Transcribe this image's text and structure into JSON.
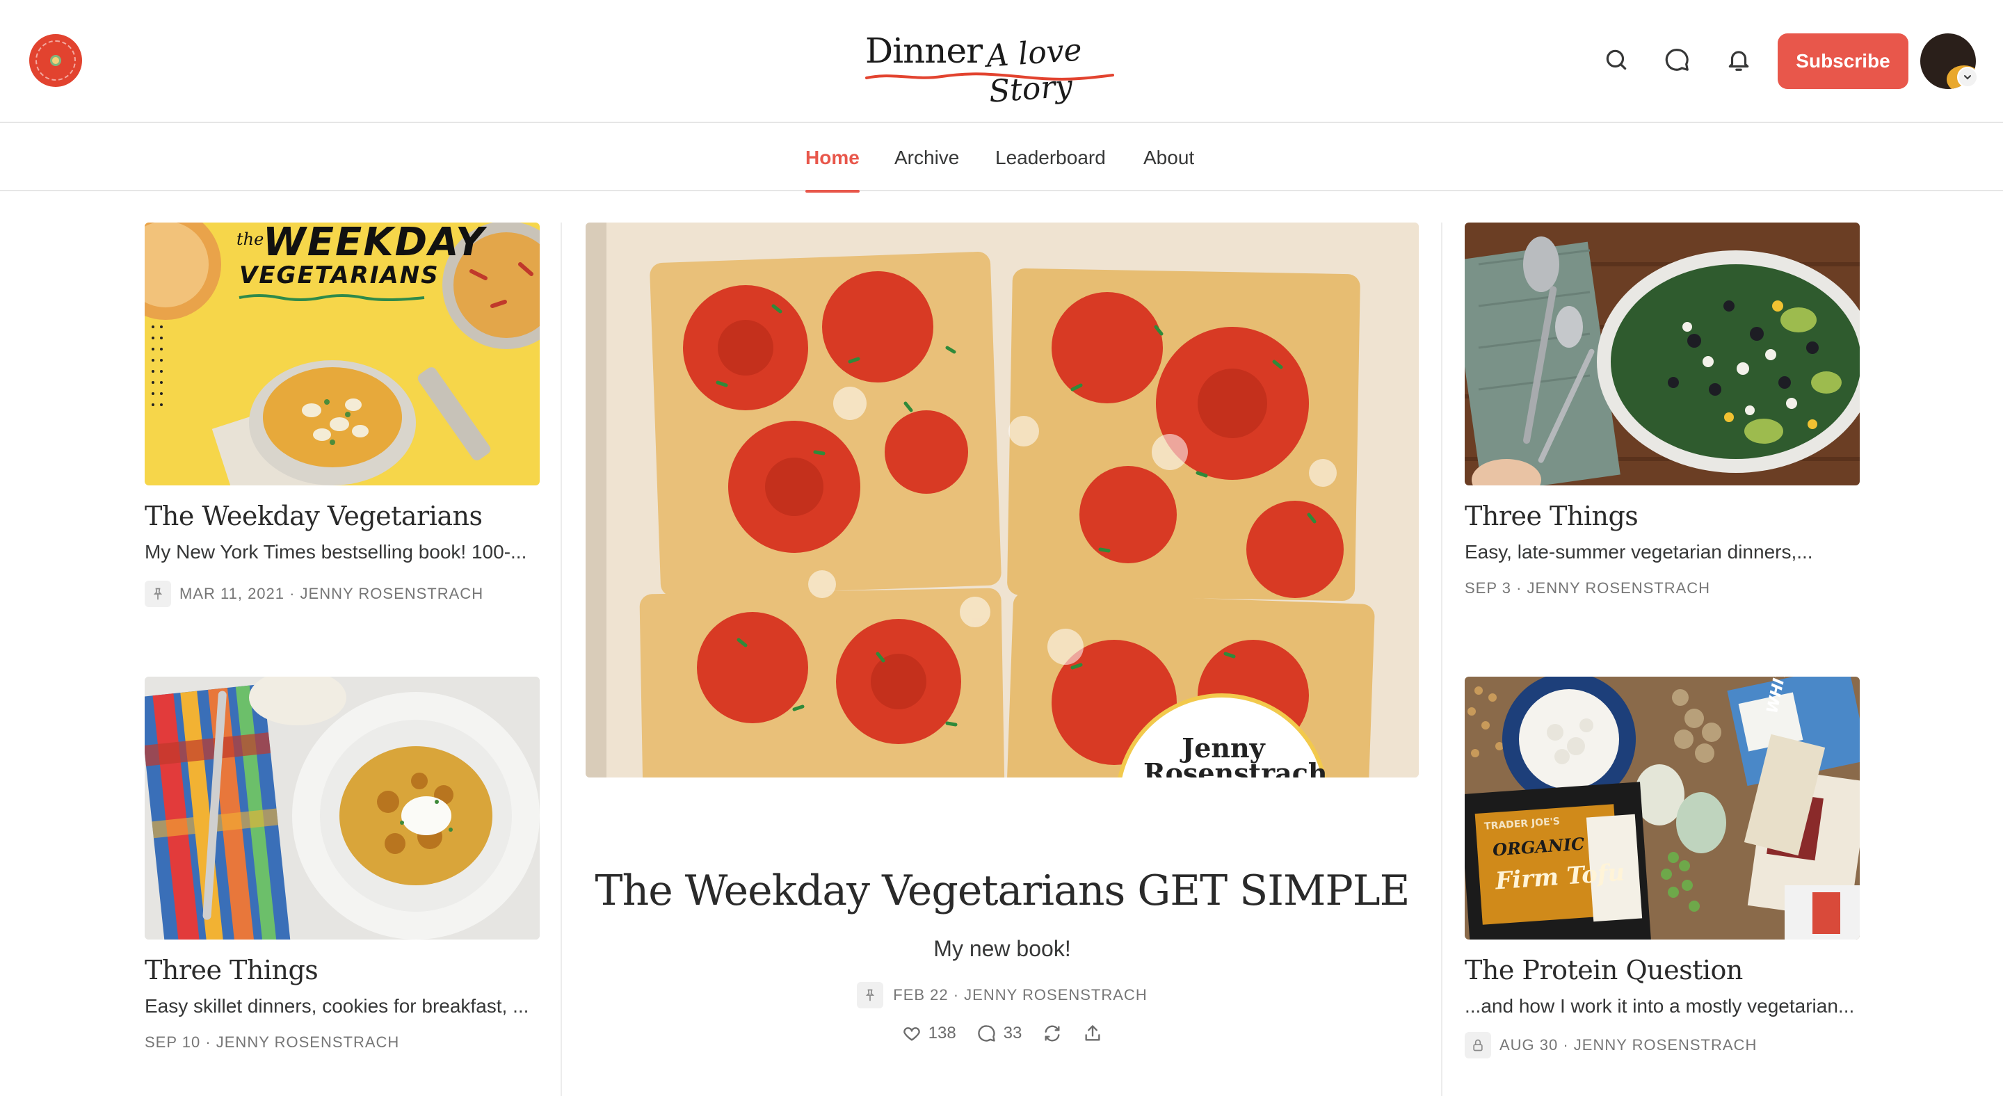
{
  "header": {
    "brand_name": "Dinner",
    "brand_tagline": "A love Story",
    "logo_text": "DINNER A LOVE STORY",
    "subscribe_label": "Subscribe",
    "icons": [
      "search-icon",
      "chat-icon",
      "bell-icon"
    ]
  },
  "nav": {
    "items": [
      {
        "label": "Home",
        "active": true
      },
      {
        "label": "Archive",
        "active": false
      },
      {
        "label": "Leaderboard",
        "active": false
      },
      {
        "label": "About",
        "active": false
      }
    ]
  },
  "left_column": [
    {
      "title": "The Weekday Vegetarians",
      "subtitle": "My New York Times bestselling book! 100-...",
      "meta": "MAR 11, 2021 · JENNY ROSENSTRACH",
      "pinned": true,
      "image_text_1": "the",
      "image_text_2": "WEEKDAY",
      "image_text_3": "VEGETARIANS"
    },
    {
      "title": "Three Things",
      "subtitle": "Easy skillet dinners, cookies for breakfast, ...",
      "meta": "SEP 10 · JENNY ROSENSTRACH",
      "pinned": false
    }
  ],
  "feature": {
    "title": "The Weekday Vegetarians GET SIMPLE",
    "subtitle": "My new book!",
    "meta": "FEB 22 · JENNY ROSENSTRACH",
    "pinned": true,
    "likes": "138",
    "comments": "33",
    "image_author_1": "Jenny",
    "image_author_2": "Rosenstrach"
  },
  "right_column": [
    {
      "title": "Three Things",
      "subtitle": "Easy, late-summer vegetarian dinners,...",
      "meta": "SEP 3 · JENNY ROSENSTRACH",
      "locked": false
    },
    {
      "title": "The Protein Question",
      "subtitle": "...and how I work it into a mostly vegetarian...",
      "meta": "AUG 30 · JENNY ROSENSTRACH",
      "locked": true,
      "image_text_tofu": "Firm Tofu",
      "image_text_brand": "TRADER JOE'S",
      "image_text_organic": "ORGANIC",
      "image_text_quinoa": "WHITE quinoa"
    }
  ],
  "colors": {
    "accent": "#e8574b",
    "text": "#363737",
    "meta": "#767676",
    "divider": "#e6e6e6"
  }
}
